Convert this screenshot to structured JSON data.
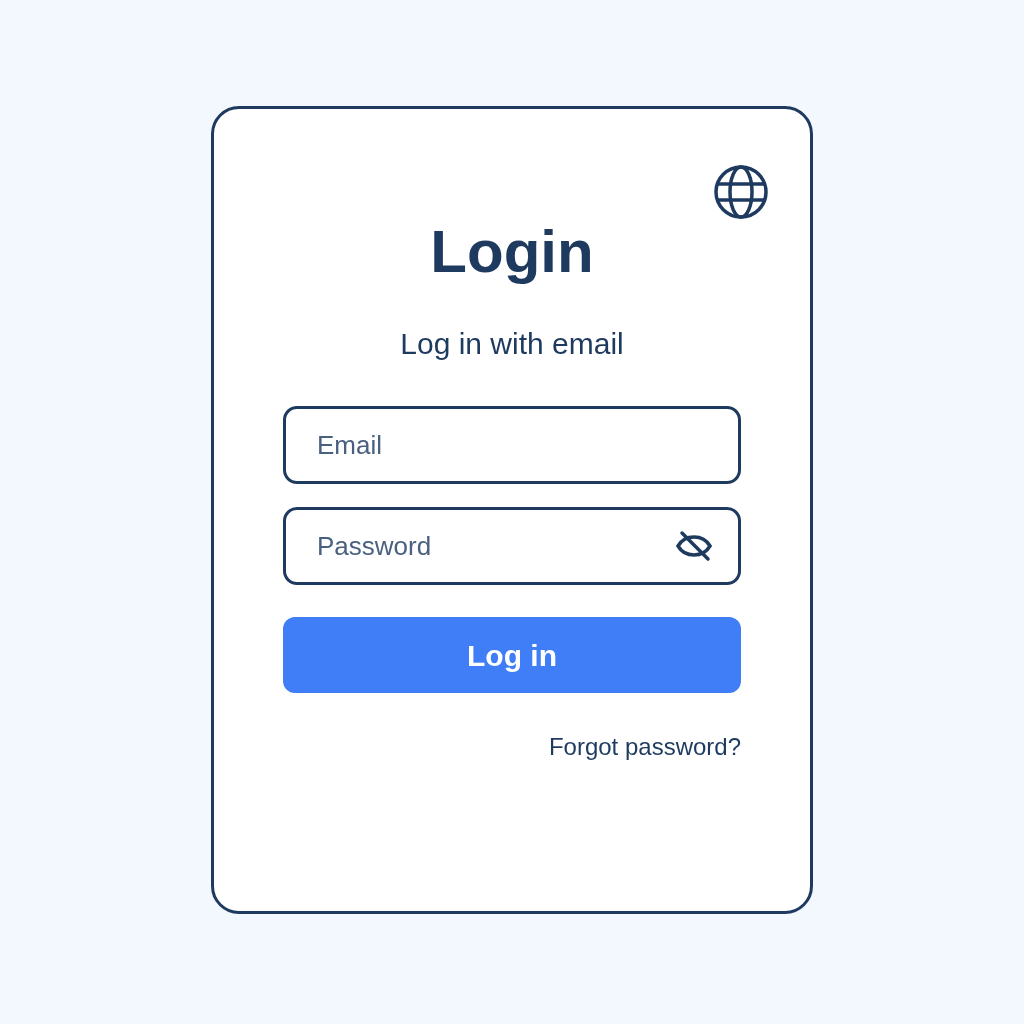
{
  "title": "Login",
  "subtitle": "Log in with email",
  "fields": [
    {
      "kind": "text",
      "placeholder": "Email"
    },
    {
      "kind": "password",
      "placeholder": "Password"
    }
  ],
  "submit_button": "Log in",
  "forgot_link": "Forgot password?"
}
